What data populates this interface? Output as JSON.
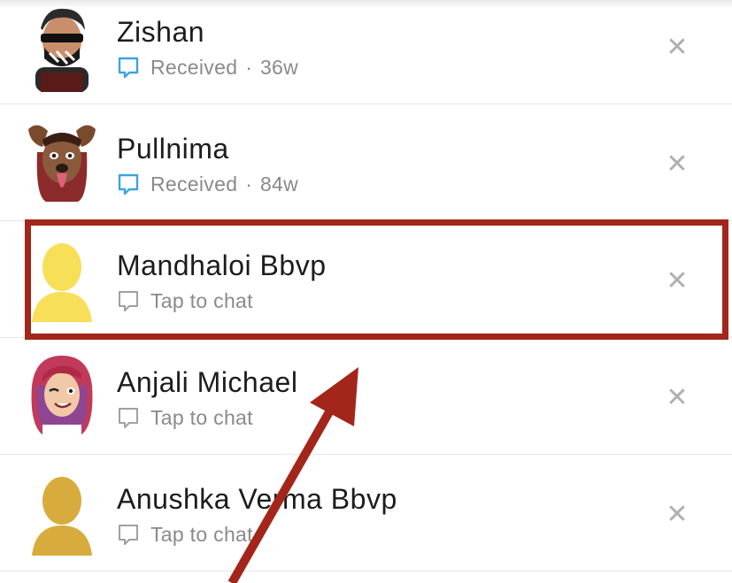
{
  "friends": [
    {
      "name": "Zishan",
      "status": "Received",
      "age": "36w",
      "icon_type": "chat-received-icon",
      "icon_color": "#3ea3e0",
      "avatar": "bitmoji-zishan"
    },
    {
      "name": "Pullnima",
      "status": "Received",
      "age": "84w",
      "icon_type": "chat-received-icon",
      "icon_color": "#3ea3e0",
      "avatar": "bitmoji-pullnima"
    },
    {
      "name": "Mandhaloi Bbvp",
      "status": "Tap to chat",
      "age": "",
      "icon_type": "chat-empty-icon",
      "icon_color": "#a0a0a0",
      "avatar": "silhouette-yellow"
    },
    {
      "name": "Anjali Michael",
      "status": "Tap to chat",
      "age": "",
      "icon_type": "chat-empty-icon",
      "icon_color": "#a0a0a0",
      "avatar": "bitmoji-anjali"
    },
    {
      "name": "Anushka Verma Bbvp",
      "status": "Tap to chat",
      "age": "",
      "icon_type": "chat-empty-icon",
      "icon_color": "#a0a0a0",
      "avatar": "silhouette-gold"
    }
  ],
  "separator": "·",
  "remove_symbol": "✕",
  "colors": {
    "highlight": "#a3261b",
    "arrow": "#a3261b",
    "silhouette_yellow": "#f7df58",
    "silhouette_gold": "#d8ac3c"
  }
}
